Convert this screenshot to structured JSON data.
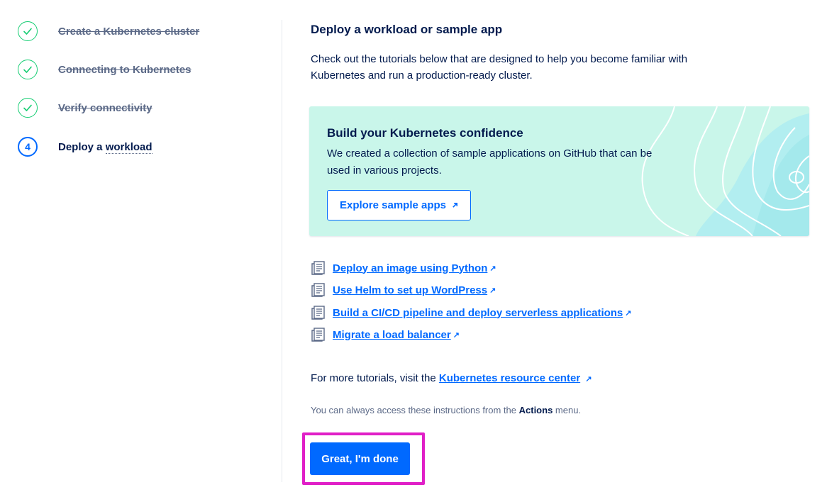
{
  "steps": [
    {
      "label": "Create a Kubernetes cluster",
      "status": "done"
    },
    {
      "label": "Connecting to Kubernetes",
      "status": "done"
    },
    {
      "label": "Verify connectivity",
      "status": "done"
    },
    {
      "number": "4",
      "label_prefix": "Deploy a ",
      "label_link": "workload",
      "status": "current"
    }
  ],
  "main": {
    "title": "Deploy a workload or sample app",
    "description": "Check out the tutorials below that are designed to help you become familiar with Kubernetes and run a production-ready cluster."
  },
  "card": {
    "title": "Build your Kubernetes confidence",
    "text": "We created a collection of sample applications on GitHub that can be used in various projects.",
    "button_label": "Explore sample apps"
  },
  "tutorials": [
    "Deploy an image using Python",
    "Use Helm to set up WordPress",
    "Build a CI/CD pipeline and deploy serverless applications",
    "Migrate a load balancer"
  ],
  "more": {
    "prefix": "For more tutorials, visit the ",
    "link": "Kubernetes resource center"
  },
  "note": {
    "prefix": "You can always access these instructions from the ",
    "bold": "Actions",
    "suffix": " menu."
  },
  "done_button": "Great, I'm done",
  "icons": {
    "step_done": "check-icon",
    "external": "external-link-icon",
    "tutorial": "document-icon"
  },
  "colors": {
    "primary": "#0069ff",
    "success": "#15cd72",
    "text": "#031b4e",
    "muted": "#5b6987",
    "card_bg": "#c9f6ea",
    "highlight": "#e01fc7"
  }
}
